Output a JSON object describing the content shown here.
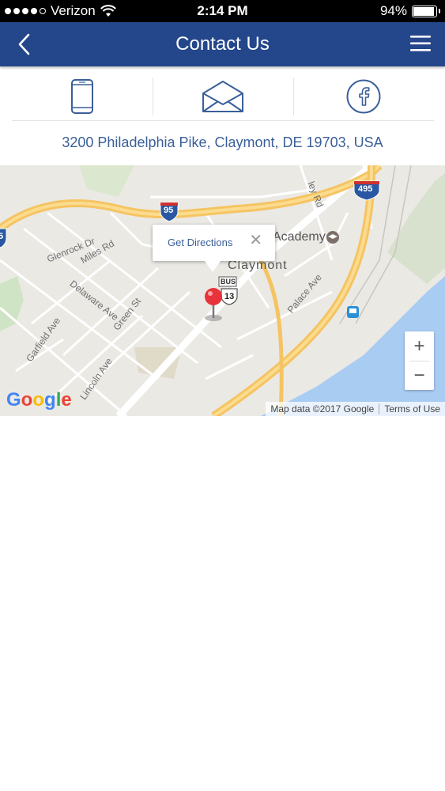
{
  "status_bar": {
    "carrier": "Verizon",
    "time": "2:14 PM",
    "battery_percent": "94%",
    "battery_level": 0.94,
    "signal_bars": 4,
    "icons": [
      "signal-dots-icon",
      "wifi-icon",
      "battery-icon"
    ]
  },
  "nav": {
    "title": "Contact Us",
    "back_icon": "chevron-left-icon",
    "menu_icon": "hamburger-menu-icon",
    "background": "#24468a"
  },
  "contact_actions": [
    {
      "name": "phone",
      "icon": "phone-icon"
    },
    {
      "name": "email",
      "icon": "envelope-icon"
    },
    {
      "name": "facebook",
      "icon": "facebook-icon"
    }
  ],
  "address": "3200 Philadelphia Pike, Claymont, DE 19703, USA",
  "map": {
    "popup_link": "Get Directions",
    "popup_close": "✕",
    "labels": {
      "claymont": "Claymont",
      "academy": "Academy",
      "glenrock": "Glenrock Dr",
      "miles": "Miles Rd",
      "delaware": "Delaware Ave",
      "green": "Green St",
      "garfield": "Garfield Ave",
      "lincoln": "Lincoln Ave",
      "palace": "Palace Ave",
      "ley": "ley Rd",
      "i95": "95",
      "i495": "495",
      "bus": "BUS",
      "us13": "13",
      "left5": "5"
    },
    "zoom_in": "+",
    "zoom_out": "−",
    "google": "Google",
    "attribution": "Map data ©2017 Google",
    "terms": "Terms of Use",
    "accent_colors": {
      "water": "#a9ccf3",
      "highway": "#f5c462",
      "pin": "#e8333a"
    }
  }
}
